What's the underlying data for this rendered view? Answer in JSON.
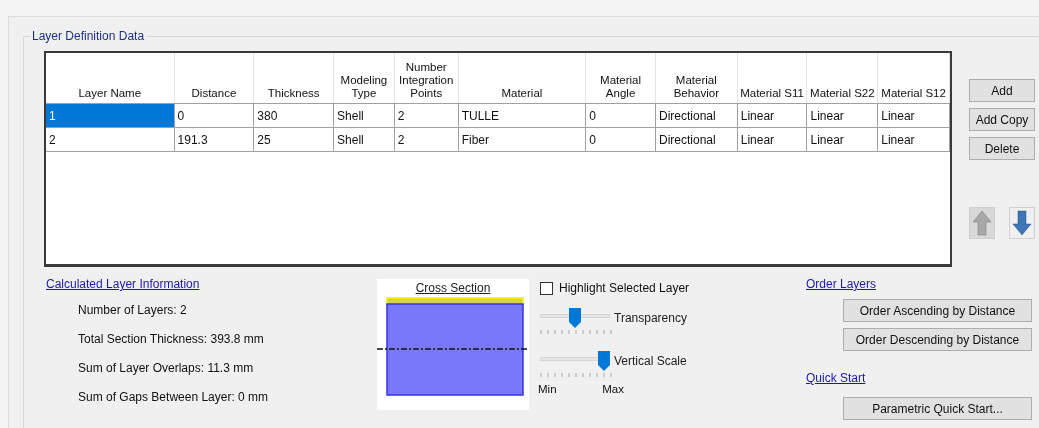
{
  "group_title": "Layer Definition Data",
  "table": {
    "columns": [
      "Layer Name",
      "Distance",
      "Thickness",
      "Modeling Type",
      "Number Integration Points",
      "Material",
      "Material Angle",
      "Material Behavior",
      "Material S11",
      "Material S22",
      "Material S12"
    ],
    "rows": [
      {
        "selected": true,
        "cells": [
          "1",
          "0",
          "380",
          "Shell",
          "2",
          "TULLE",
          "0",
          "Directional",
          "Linear",
          "Linear",
          "Linear"
        ]
      },
      {
        "selected": false,
        "cells": [
          "2",
          "191.3",
          "25",
          "Shell",
          "2",
          "Fiber",
          "0",
          "Directional",
          "Linear",
          "Linear",
          "Linear"
        ]
      }
    ]
  },
  "side_buttons": [
    "Add",
    "Add Copy",
    "Delete"
  ],
  "move_buttons": [
    {
      "kind": "up",
      "disabled": true
    },
    {
      "kind": "down",
      "disabled": false
    }
  ],
  "calculated": {
    "title": "Calculated Layer Information",
    "lines": [
      "Number of Layers:  2",
      "Total Section Thickness:  393.8 mm",
      "Sum of Layer Overlaps:  11.3 mm",
      "Sum of Gaps Between Layer:  0 mm"
    ]
  },
  "cross_section": {
    "title": "Cross Section"
  },
  "highlight_checkbox": {
    "label": "Highlight Selected Layer",
    "checked": false
  },
  "sliders": [
    {
      "label": "Transparency",
      "level": 0.5
    },
    {
      "label": "Vertical Scale",
      "level": 1.0
    }
  ],
  "slider_range": {
    "min": "Min",
    "max": "Max"
  },
  "order_layers": {
    "title": "Order Layers",
    "buttons": [
      "Order Ascending by Distance",
      "Order Descending by Distance"
    ]
  },
  "quick_start": {
    "title": "Quick Start",
    "button": "Parametric Quick Start..."
  }
}
